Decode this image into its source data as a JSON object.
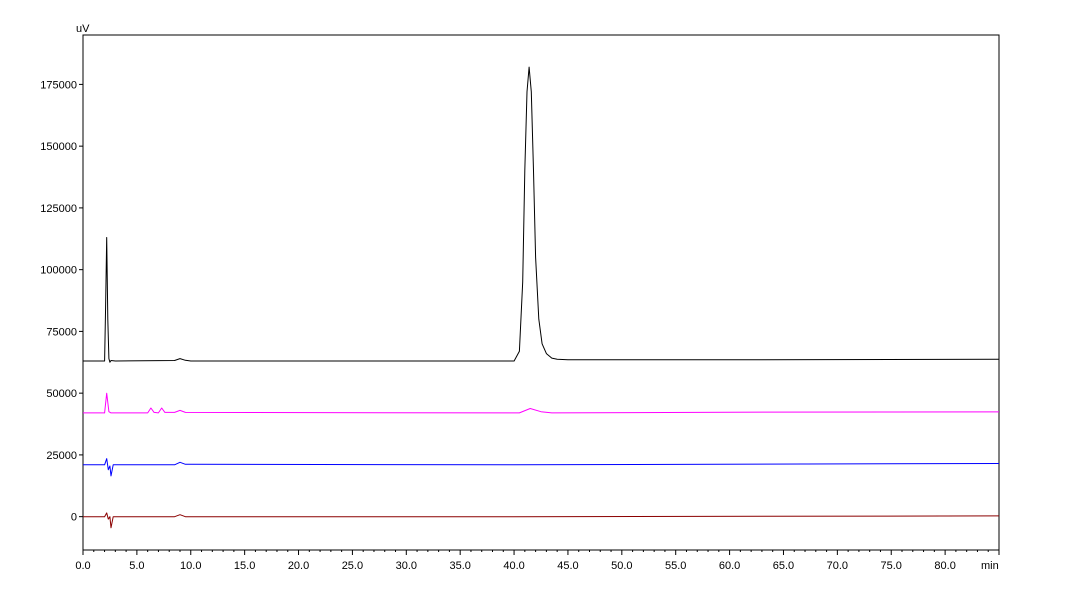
{
  "chart_data": {
    "type": "line",
    "title": "",
    "xlabel": "min",
    "ylabel": "uV",
    "xlim": [
      0,
      85
    ],
    "ylim": [
      -13500,
      195000
    ],
    "grid": false,
    "legend": "none",
    "x_ticks": [
      0,
      5,
      10,
      15,
      20,
      25,
      30,
      35,
      40,
      45,
      50,
      55,
      60,
      65,
      70,
      75,
      80
    ],
    "x_tick_labels": [
      "0.0",
      "5.0",
      "10.0",
      "15.0",
      "20.0",
      "25.0",
      "30.0",
      "35.0",
      "40.0",
      "45.0",
      "50.0",
      "55.0",
      "60.0",
      "65.0",
      "70.0",
      "75.0",
      "80.0"
    ],
    "y_ticks": [
      0,
      25000,
      50000,
      75000,
      100000,
      125000,
      150000,
      175000
    ],
    "y_tick_labels": [
      "0",
      "25000",
      "50000",
      "75000",
      "100000",
      "125000",
      "150000",
      "175000"
    ],
    "series": [
      {
        "color": "#000000",
        "x": [
          0,
          2.0,
          2.1,
          2.2,
          2.3,
          2.4,
          2.5,
          2.6,
          3.0,
          8.5,
          9.0,
          9.5,
          10.0,
          20,
          40.0,
          40.5,
          40.8,
          41.0,
          41.2,
          41.4,
          41.6,
          41.8,
          42.0,
          42.3,
          42.6,
          43.0,
          43.5,
          44.0,
          45.0,
          60,
          85
        ],
        "y": [
          63000,
          63000,
          85000,
          113000,
          80000,
          64000,
          62500,
          63200,
          63000,
          63200,
          64000,
          63300,
          63000,
          63000,
          63000,
          67000,
          95000,
          140000,
          172000,
          182000,
          172000,
          140000,
          105000,
          80000,
          70000,
          66000,
          64200,
          63700,
          63500,
          63500,
          63700
        ]
      },
      {
        "color": "#ff00ff",
        "x": [
          0,
          2.0,
          2.2,
          2.4,
          2.6,
          6.0,
          6.3,
          6.6,
          7.0,
          7.3,
          7.6,
          8.5,
          9.0,
          9.5,
          40.5,
          41.5,
          42.5,
          43.5,
          60,
          85
        ],
        "y": [
          42000,
          42000,
          50000,
          42500,
          42000,
          42000,
          44000,
          42200,
          42000,
          44000,
          42200,
          42200,
          43000,
          42200,
          42000,
          43800,
          42500,
          42000,
          42300,
          42400
        ]
      },
      {
        "color": "#0000ff",
        "x": [
          0,
          2.0,
          2.2,
          2.35,
          2.5,
          2.6,
          2.8,
          8.5,
          9.0,
          9.5,
          40,
          85
        ],
        "y": [
          21000,
          21000,
          23500,
          19000,
          20500,
          16500,
          21000,
          21000,
          22000,
          21200,
          21000,
          21500
        ]
      },
      {
        "color": "#8b0000",
        "x": [
          0,
          2.0,
          2.2,
          2.35,
          2.5,
          2.6,
          2.8,
          8.5,
          9.0,
          9.5,
          40,
          85
        ],
        "y": [
          0,
          0,
          1500,
          -1000,
          0,
          -4500,
          0,
          0,
          800,
          0,
          0,
          300
        ]
      }
    ]
  }
}
